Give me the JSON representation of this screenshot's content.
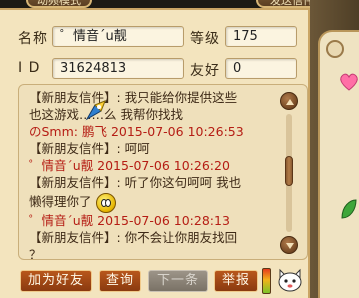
{
  "tabs": {
    "left": "动频模式",
    "right": "发送信件"
  },
  "profile": {
    "name_label": "名称",
    "name_value": "゜情音´u靓",
    "level_label": "等级",
    "level_value": "175",
    "id_label": "I D",
    "id_value": "31624813",
    "friendship_label": "友好",
    "friendship_value": "0"
  },
  "chat": {
    "lines": [
      {
        "text": "【新朋友信件】: 我只能给你提供这些",
        "ts": false
      },
      {
        "text": "也这游戏……么 我帮你找找",
        "ts": false
      },
      {
        "text": "のSmm: 鹏飞 2015-07-06 10:26:53",
        "ts": true
      },
      {
        "text": "【新朋友信件】: 呵呵",
        "ts": false
      },
      {
        "text": "゜情音´u靓 2015-07-06 10:26:20",
        "ts": true
      },
      {
        "text": "【新朋友信件】: 听了你这句呵呵 我也",
        "ts": false
      },
      {
        "text": "懒得理你了",
        "ts": false
      },
      {
        "text": "゜情音´u靓 2015-07-06 10:28:13",
        "ts": true
      },
      {
        "text": "【新朋友信件】: 你不会让你朋友找回",
        "ts": false
      },
      {
        "text": "？",
        "ts": false
      }
    ]
  },
  "buttons": {
    "add_friend": "加为好友",
    "query": "查询",
    "next": "下一条",
    "report": "举报"
  },
  "colors": {
    "panel": "#f3e4be",
    "timestamp": "#b51d14",
    "button": "#b8571b",
    "button_disabled": "#9c9488"
  }
}
